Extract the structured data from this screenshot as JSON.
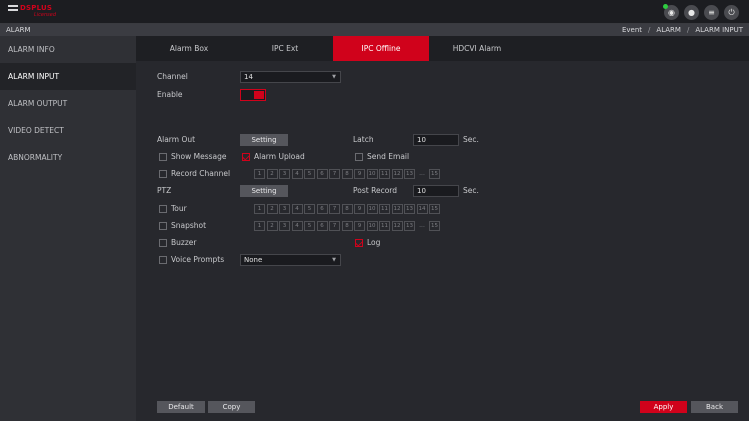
{
  "brand": {
    "name": "DSPLUS",
    "sub": "Licensed"
  },
  "header_icons": [
    "eye-icon",
    "user-icon",
    "menu-icon",
    "power-icon"
  ],
  "titlebar": {
    "title": "ALARM",
    "breadcrumb": [
      "Event",
      "ALARM",
      "ALARM INPUT"
    ]
  },
  "sidebar": {
    "items": [
      "ALARM INFO",
      "ALARM INPUT",
      "ALARM OUTPUT",
      "VIDEO DETECT",
      "ABNORMALITY"
    ],
    "active": 1
  },
  "tabs": {
    "items": [
      "Alarm Box",
      "IPC Ext",
      "IPC Offline",
      "HDCVI Alarm"
    ],
    "active": 2
  },
  "form": {
    "channel_label": "Channel",
    "channel_value": "14",
    "enable_label": "Enable",
    "enable_on": true,
    "alarm_out_label": "Alarm Out",
    "setting_label": "Setting",
    "latch_label": "Latch",
    "latch_value": "10",
    "sec_label": "Sec.",
    "show_message": "Show Message",
    "alarm_upload": "Alarm Upload",
    "send_email": "Send Email",
    "record_channel": "Record Channel",
    "ptz_label": "PTZ",
    "ptz_setting_label": "Setting",
    "post_record_label": "Post Record",
    "post_record_value": "10",
    "sec_label2": "Sec.",
    "tour": "Tour",
    "snapshot": "Snapshot",
    "buzzer": "Buzzer",
    "log": "Log",
    "voice_prompts": "Voice Prompts",
    "voice_value": "None",
    "numbers": [
      "1",
      "2",
      "3",
      "4",
      "5",
      "6",
      "7",
      "8",
      "9",
      "10",
      "11",
      "12",
      "13",
      "...",
      "15"
    ],
    "numbers_full": [
      "1",
      "2",
      "3",
      "4",
      "5",
      "6",
      "7",
      "8",
      "9",
      "10",
      "11",
      "12",
      "13",
      "14",
      "15"
    ]
  },
  "footer": {
    "default": "Default",
    "copy": "Copy",
    "apply": "Apply",
    "back": "Back"
  },
  "colors": {
    "accent": "#d0021b"
  }
}
